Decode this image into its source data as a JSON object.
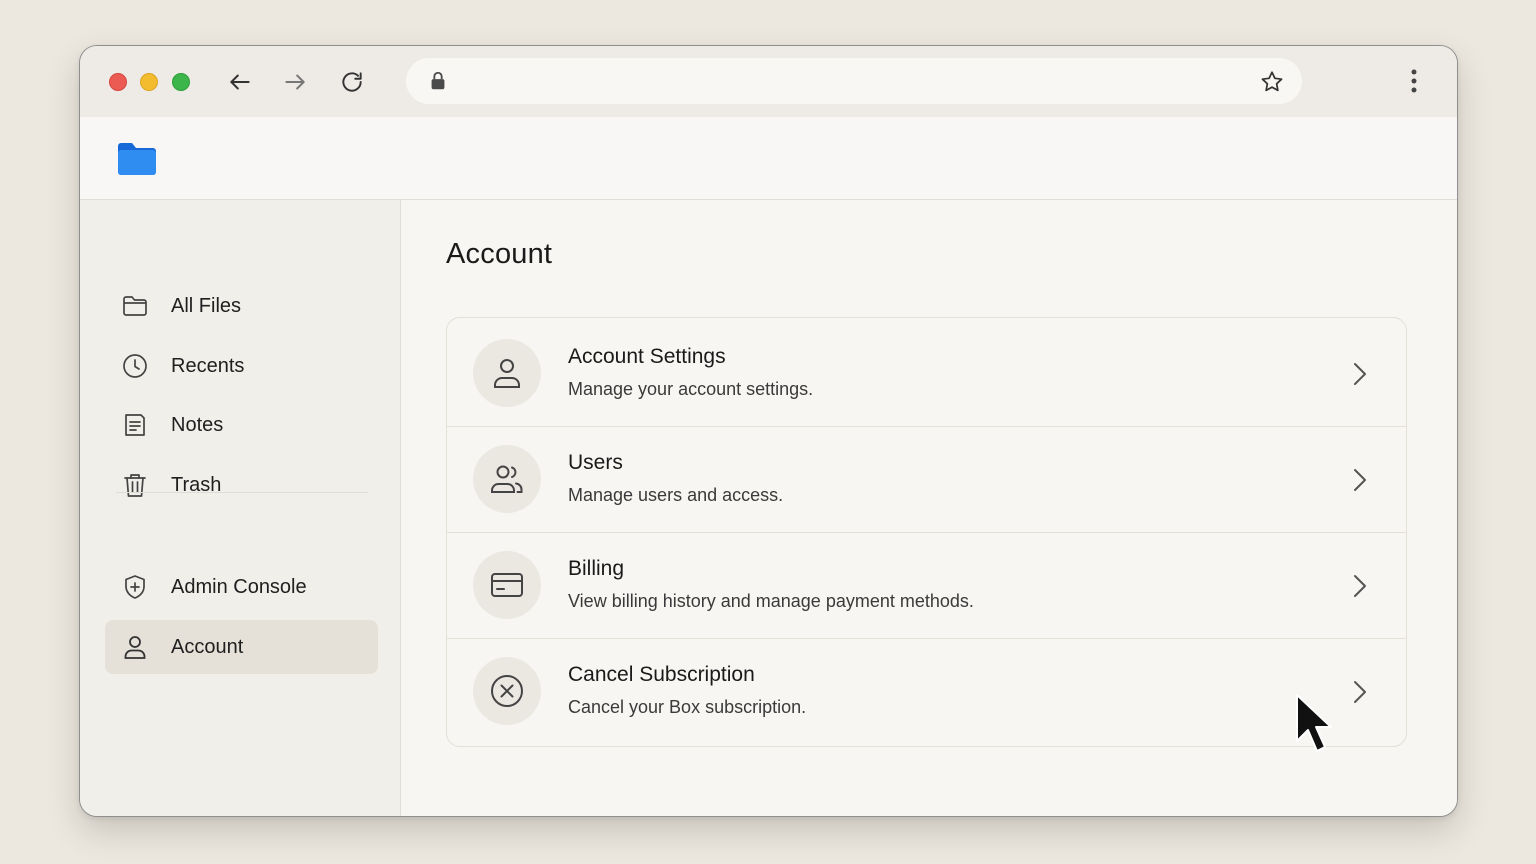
{
  "browser": {
    "address_placeholder": "",
    "icons": {
      "back": "arrow-left-icon",
      "forward": "arrow-right-icon",
      "reload": "reload-icon",
      "lock": "lock-icon",
      "bookmark": "star-icon",
      "menu": "kebab-menu-icon"
    }
  },
  "app": {
    "logo_icon": "folder-logo-icon",
    "brand_color": "#1a73e8"
  },
  "sidebar": {
    "items": [
      {
        "label": "All Files",
        "icon": "folder-icon",
        "active": false
      },
      {
        "label": "Recents",
        "icon": "clock-icon",
        "active": false
      },
      {
        "label": "Notes",
        "icon": "note-icon",
        "active": false
      },
      {
        "label": "Trash",
        "icon": "trash-icon",
        "active": false
      }
    ],
    "admin_items": [
      {
        "label": "Admin Console",
        "icon": "shield-plus-icon",
        "active": false
      },
      {
        "label": "Account",
        "icon": "user-icon",
        "active": true
      }
    ]
  },
  "main": {
    "title": "Account",
    "rows": [
      {
        "title": "Account Settings",
        "description": "Manage your account settings.",
        "icon": "user-icon"
      },
      {
        "title": "Users",
        "description": "Manage users and access.",
        "icon": "users-icon"
      },
      {
        "title": "Billing",
        "description": "View billing history and manage payment methods.",
        "icon": "credit-card-icon"
      },
      {
        "title": "Cancel Subscription",
        "description": "Cancel your Box subscription.",
        "icon": "x-circle-icon"
      }
    ]
  },
  "colors": {
    "traffic_red": "#ec5b53",
    "traffic_yellow": "#f3bc2f",
    "traffic_green": "#3cb54a",
    "active_item_bg": "#e5e1d8"
  }
}
